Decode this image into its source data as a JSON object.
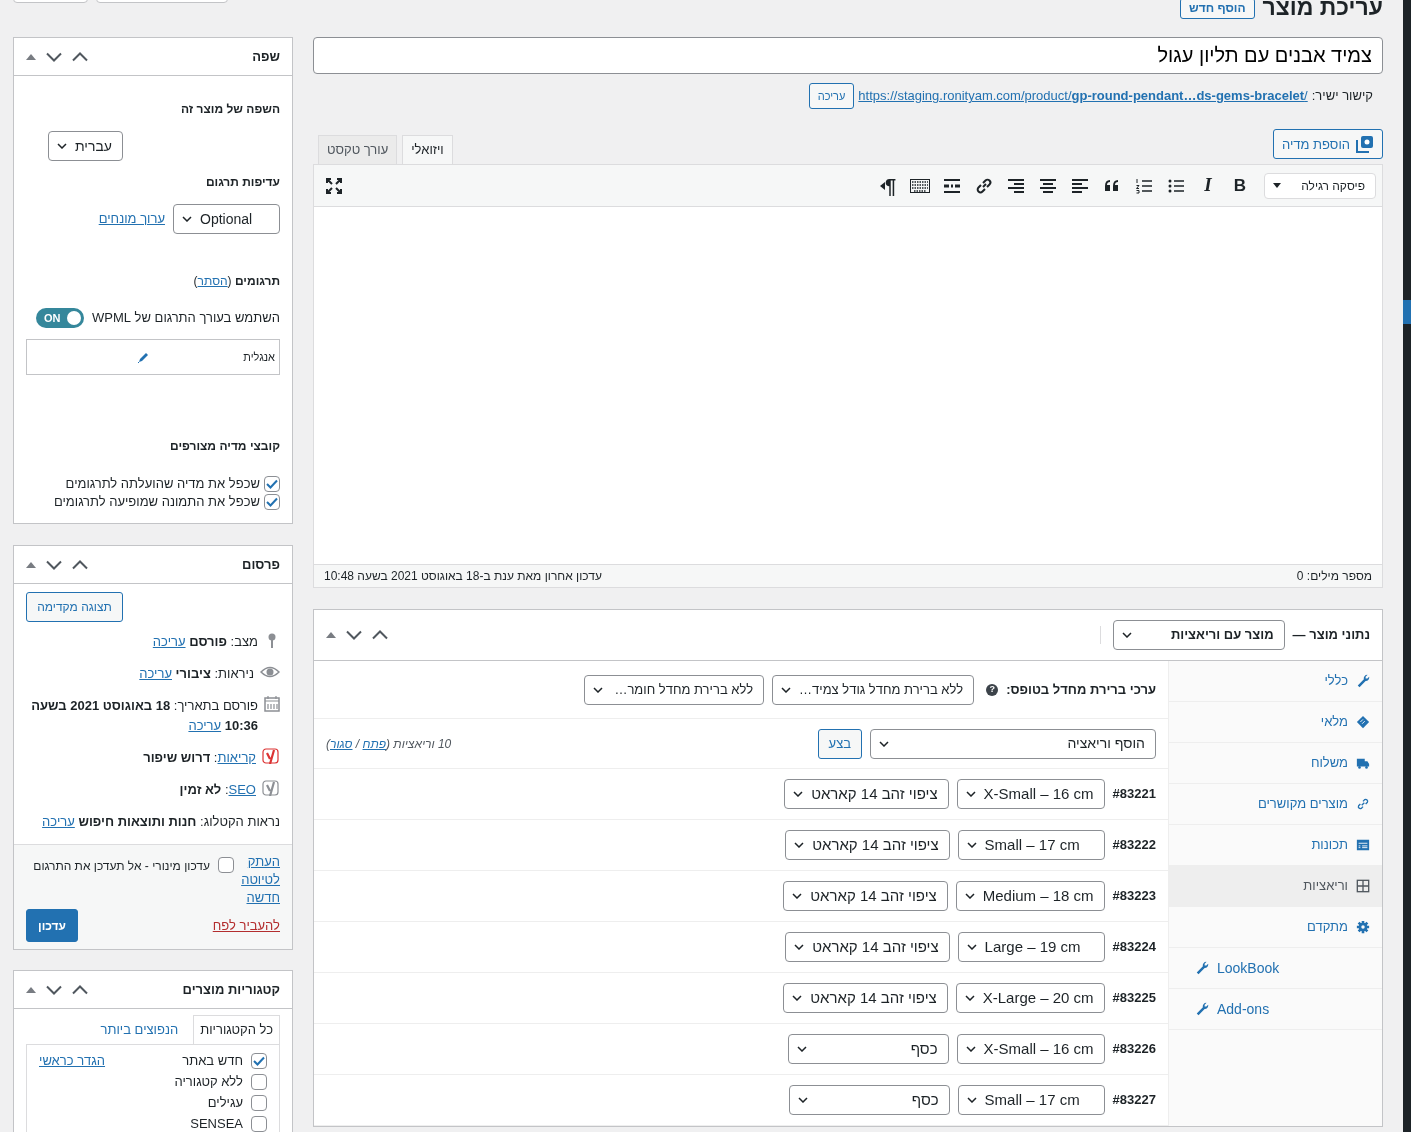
{
  "header": {
    "title": "עריכת מוצר",
    "add_new": "הוסף חדש"
  },
  "product_title": "צמיד אבנים עם תליון עגול",
  "permalink": {
    "label": "קישור ישיר:",
    "url": "https://staging.ronityam.com/product/**gp-round-pendant…ds-gems-bracelet**/",
    "edit": "עריכה"
  },
  "editor": {
    "add_media": "הוספת מדיה",
    "tabs": [
      {
        "label": "ויזואלי",
        "selected": true
      },
      {
        "label": "עורך טקסט",
        "selected": false
      }
    ],
    "format": "פיסקה רגילה",
    "buttons": [
      {
        "kind": "bold",
        "glyph": "B"
      },
      {
        "kind": "italic",
        "glyph": "I"
      },
      {
        "kind": "bullet-list"
      },
      {
        "kind": "numbered-list"
      },
      {
        "kind": "blockquote"
      },
      {
        "kind": "align-left"
      },
      {
        "kind": "align-center"
      },
      {
        "kind": "align-right"
      },
      {
        "kind": "link"
      },
      {
        "kind": "read-more"
      },
      {
        "kind": "toolbar-toggle"
      },
      {
        "kind": "direction",
        "glyph": "¶"
      }
    ],
    "word_count": "מספר מילים: 0",
    "last_edit": "עדכון אחרון מאת ענת ב-18 באוגוסט 2021 בשעה 10:48"
  },
  "product_data": {
    "title": "נתוני מוצר —",
    "type": "מוצר עם וריאציות",
    "tabs": [
      {
        "label": "כללי",
        "selected": false
      },
      {
        "label": "מלאי",
        "selected": false
      },
      {
        "label": "משלוח",
        "selected": false
      },
      {
        "label": "מוצרים מקושרים",
        "selected": false
      },
      {
        "label": "תכונות",
        "selected": false
      },
      {
        "label": "וריאציות",
        "selected": true
      },
      {
        "label": "מתקדם",
        "selected": false
      },
      {
        "label": "LookBook",
        "selected": false
      },
      {
        "label": "Add-ons",
        "selected": false
      }
    ],
    "defaults_label": "ערכי ברירת מחדל בטופס:",
    "help": "?",
    "defaults": [
      "ללא ברירת מחדל גודל צמיד…",
      "ללא ברירת מחדל חומר…"
    ],
    "add_variation": "הוסף וריאציה",
    "go": "בצע",
    "count": [
      {
        "text": "10 וריאציות ("
      },
      {
        "link": "פתח"
      },
      {
        "text": " / "
      },
      {
        "link": "סגור"
      },
      {
        "text": ")"
      }
    ],
    "variations": [
      {
        "id": "#83221",
        "size": "X-Small – 16 cm",
        "material": "ציפוי זהב 14 קאראט"
      },
      {
        "id": "#83222",
        "size": "Small – 17 cm",
        "material": "ציפוי זהב 14 קאראט"
      },
      {
        "id": "#83223",
        "size": "Medium – 18 cm",
        "material": "ציפוי זהב 14 קאראט"
      },
      {
        "id": "#83224",
        "size": "Large – 19 cm",
        "material": "ציפוי זהב 14 קאראט"
      },
      {
        "id": "#83225",
        "size": "X-Large – 20 cm",
        "material": "ציפוי זהב 14 קאראט"
      },
      {
        "id": "#83226",
        "size": "X-Small – 16 cm",
        "material": "כסף"
      },
      {
        "id": "#83227",
        "size": "Small – 17 cm",
        "material": "כסף"
      }
    ]
  },
  "language_box": {
    "title": "שפה",
    "lang_label": "השפה של מוצר זה",
    "language": "עברית",
    "priority_label": "עדיפות תרגום",
    "priority": "Optional",
    "edit_terms": "ערוך מונחים",
    "translations_heading": [
      {
        "text": "**תרגומים** ("
      },
      {
        "link": "הסתר"
      },
      {
        "text": ")"
      }
    ],
    "wpml_toggle": {
      "on": true,
      "text": "ON",
      "label": "השתמש בעורך התרגום של WPML"
    },
    "translations": [
      {
        "language": "אנגלית"
      }
    ],
    "media_label": "קובצי מדיה מצורפים",
    "media_options": [
      {
        "label": "שכפל את מדיה שהועלתה לתרגומים",
        "checked": true
      },
      {
        "label": "שכפל את התמונה שמופיעה לתרגומים",
        "checked": true
      }
    ]
  },
  "publish_box": {
    "title": "פרסום",
    "preview": "תצוגה מקדימה",
    "rows": [
      {
        "kind": "status",
        "segments": [
          {
            "text": "מצב: **פורסם** "
          },
          {
            "link": "עריכה"
          }
        ]
      },
      {
        "kind": "visibility",
        "segments": [
          {
            "text": "ניראות: **ציבורי** "
          },
          {
            "link": "עריכה"
          }
        ]
      },
      {
        "kind": "date",
        "segments": [
          {
            "text": "פורסם בתאריך: **18 באוגוסט 2021 בשעה 10:36** "
          },
          {
            "link": "עריכה"
          }
        ]
      },
      {
        "kind": "readability",
        "segments": [
          {
            "link": "קריאות"
          },
          {
            "text": ": **דרוש שיפור**"
          }
        ]
      },
      {
        "kind": "seo",
        "segments": [
          {
            "link": "SEO"
          },
          {
            "text": ": **לא זמין**"
          }
        ]
      },
      {
        "kind": "catalog",
        "segments": [
          {
            "text": "נראות הקטלוג: **חנות ותוצאות חיפוש** "
          },
          {
            "link": "עריכה"
          }
        ]
      }
    ],
    "copy_draft": "העתק לטיוטה חדשה",
    "minor_update": {
      "label": "עדכון מינורי - אל תעדכן את התרגום",
      "checked": false
    },
    "trash": "להעביר לפח",
    "update": "עדכון"
  },
  "categories_box": {
    "title": "קטגוריות מוצרים",
    "tabs": [
      {
        "label": "כל הקטגוריות",
        "selected": true
      },
      {
        "label": "הנפוצים ביותר",
        "selected": false
      }
    ],
    "items": [
      {
        "label": "חדש באתר",
        "checked": true,
        "primary_link": "הגדר כראשי"
      },
      {
        "label": "ללא קטגוריה",
        "checked": false
      },
      {
        "label": "עגילים",
        "checked": false
      },
      {
        "label": "SENSEA",
        "checked": false
      }
    ]
  }
}
